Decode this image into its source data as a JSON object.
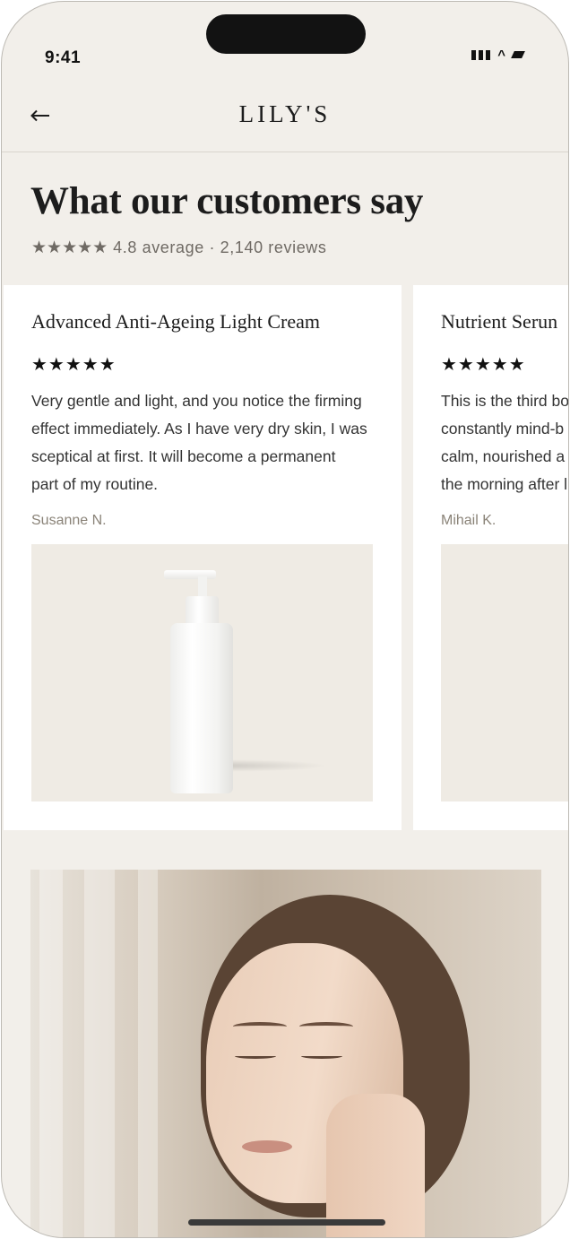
{
  "status_bar": {
    "time": "9:41"
  },
  "nav": {
    "brand": "LILY'S"
  },
  "page": {
    "heading": "What our customers say",
    "rating_stars": "★★★★★",
    "rating_summary": "4.8 average · 2,140 reviews",
    "rating_average": 4.8,
    "review_count": 2140
  },
  "reviews": [
    {
      "product": "Advanced Anti-Ageing Light Cream",
      "stars": "★★★★★",
      "text": "Very gentle and light, and you notice the firming\neffect immediately. As I have very dry skin, I was\nsceptical at first. It will become a permanent\npart of my routine.",
      "author": "Susanne N."
    },
    {
      "product": "Nutrient Serun",
      "stars": "★★★★★",
      "text": "This is the third bo\nconstantly mind-b\ncalm, nourished a\nthe morning after l",
      "author": "Mihail K."
    }
  ],
  "icons": {
    "back": "back-arrow-icon",
    "signal": "signal-icon",
    "wifi": "wifi-icon",
    "battery": "battery-icon"
  },
  "colors": {
    "background": "#f2efea",
    "card": "#ffffff",
    "text": "#1c1c1c",
    "muted": "#6f6a64",
    "author": "#8a8378",
    "image_bg": "#efebe4"
  }
}
